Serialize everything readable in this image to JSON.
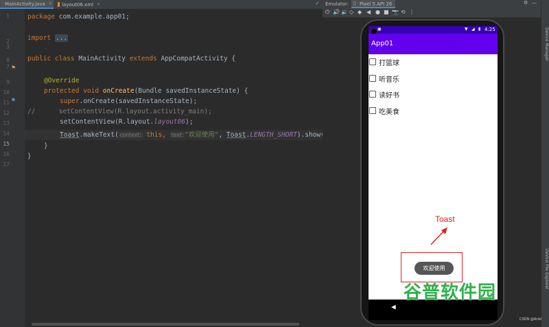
{
  "tabs": [
    {
      "label": "MainActivity.java",
      "color": "#4a88c7",
      "active": true
    },
    {
      "label": "layout06.xml",
      "color": "#e0853c",
      "active": false
    }
  ],
  "line_numbers": [
    "1",
    "2",
    "3",
    "7",
    "8",
    "9",
    "10",
    "11",
    "12",
    "13",
    "14",
    "15",
    "16",
    "17"
  ],
  "code": {
    "l1_kw": "package",
    "l1_rest": " com.example.app01;",
    "l3_kw": "import",
    "l3_fold": "...",
    "l8_kw": "public class",
    "l8_name": " MainActivity ",
    "l8_ext": "extends",
    "l8_rest": " AppCompatActivity {",
    "l10": "@Override",
    "l11_kw": "protected void",
    "l11_fn": " onCreate",
    "l11_rest": "(Bundle savedInstanceState) {",
    "l12_kw": "super",
    "l12_rest": ".onCreate(savedInstanceState);",
    "l13": "//      setContentView(R.layout.activity_main);",
    "l14_a": "setContentView(R.layout.",
    "l14_it": "layout06",
    "l14_b": ");",
    "l15_a": "Toast",
    "l15_b": ".makeText(",
    "l15_hint1": "context:",
    "l15_this": " this,",
    "l15_hint2": "text:",
    "l15_str": "\"欢迎使用\"",
    "l15_c": ", ",
    "l15_d": "Toast",
    "l15_e": ".",
    "l15_it": "LENGTH_SHORT",
    "l15_f": ").show();",
    "l16": "}",
    "l17": "}"
  },
  "emulator": {
    "label": "Emulator:",
    "device": "Pixel 5 API 26",
    "side_panels": [
      "Device Manager",
      "Device File Explorer"
    ]
  },
  "phone": {
    "time": "4:25",
    "app_title": "App01",
    "checkboxes": [
      "打篮球",
      "听音乐",
      "读好书",
      "吃美食"
    ],
    "toast_text": "欢迎使用",
    "back_glyph": "◀"
  },
  "annotation": {
    "label": "Toast"
  },
  "watermark": "谷普软件园",
  "credit": "CSDN @Ariel"
}
